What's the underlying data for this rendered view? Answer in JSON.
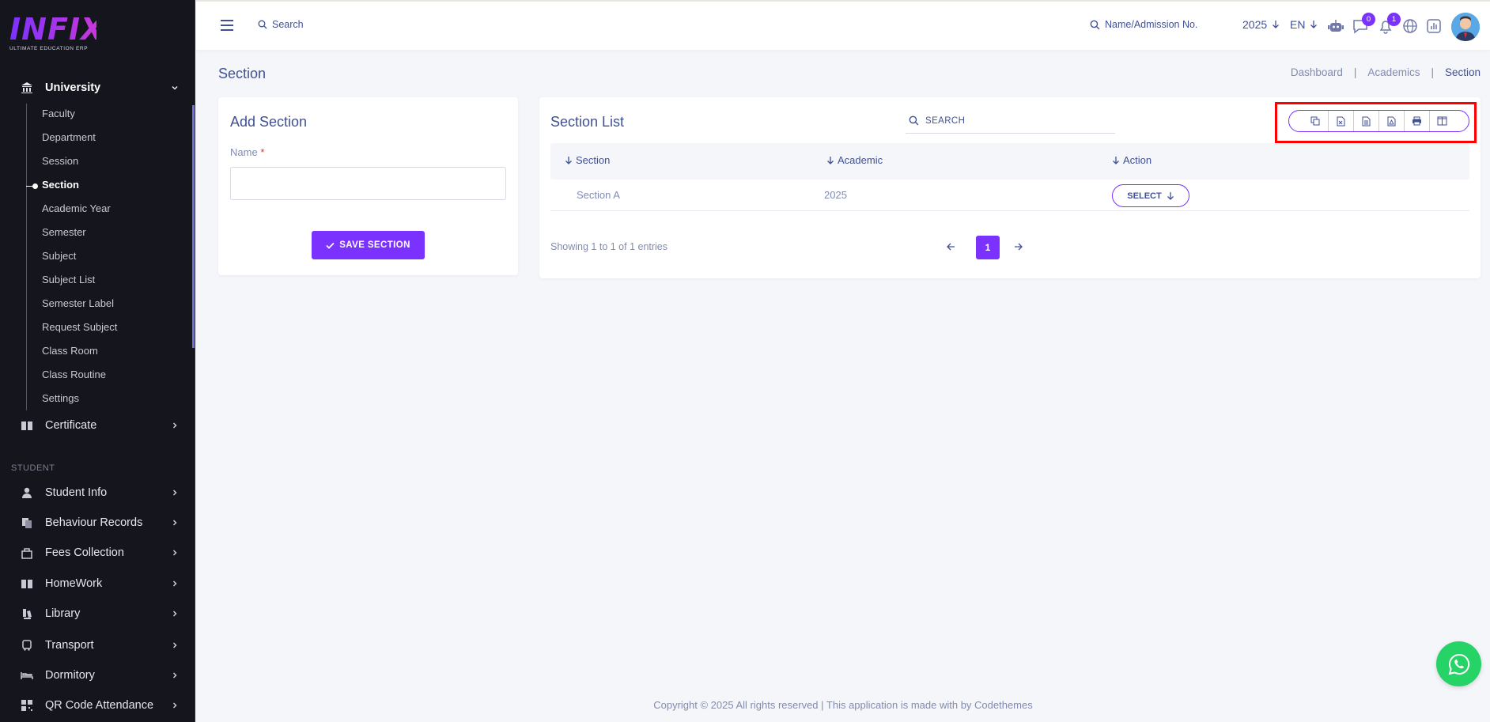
{
  "sidebar": {
    "logo_text": "INFIX",
    "logo_subtitle": "ULTIMATE EDUCATION ERP",
    "university": {
      "label": "University",
      "icon": "university-icon"
    },
    "sub_items": [
      "Faculty",
      "Department",
      "Session",
      "Section",
      "Academic Year",
      "Semester",
      "Subject",
      "Subject List",
      "Semester Label",
      "Request Subject",
      "Class Room",
      "Class Routine",
      "Settings"
    ],
    "active_sub_item": "Section",
    "certificate": "Certificate",
    "student_section_label": "STUDENT",
    "student_items": [
      "Student Info",
      "Behaviour Records",
      "Fees Collection",
      "HomeWork",
      "Library",
      "Transport",
      "Dormitory",
      "QR Code Attendance"
    ]
  },
  "topbar": {
    "search_label": "Search",
    "name_search_label": "Name/Admission No.",
    "year": "2025",
    "language": "EN",
    "chat_badge": "0",
    "notification_badge": "1"
  },
  "page": {
    "title": "Section",
    "breadcrumb": [
      "Dashboard",
      "Academics",
      "Section"
    ]
  },
  "add_section": {
    "title": "Add Section",
    "name_label": "Name",
    "required_mark": "*",
    "name_value": "",
    "save_label": "SAVE SECTION"
  },
  "section_list": {
    "title": "Section List",
    "search_placeholder": "SEARCH",
    "columns": [
      "Section",
      "Academic",
      "Action"
    ],
    "rows": [
      {
        "section": "Section A",
        "academic": "2025",
        "action": "SELECT"
      }
    ],
    "showing": "Showing 1 to 1 of 1 entries",
    "current_page": "1",
    "export_buttons": [
      "copy-icon",
      "excel-icon",
      "csv-icon",
      "pdf-icon",
      "print-icon",
      "columns-icon"
    ]
  },
  "footer": {
    "text": "Copyright © 2025 All rights reserved | This application is made with by Codethemes"
  },
  "colors": {
    "primary": "#7c32ff",
    "sidebar_bg": "#15151d",
    "text": "#415094",
    "muted": "#828bb2",
    "whatsapp": "#25d366",
    "highlight": "#ff0000"
  }
}
